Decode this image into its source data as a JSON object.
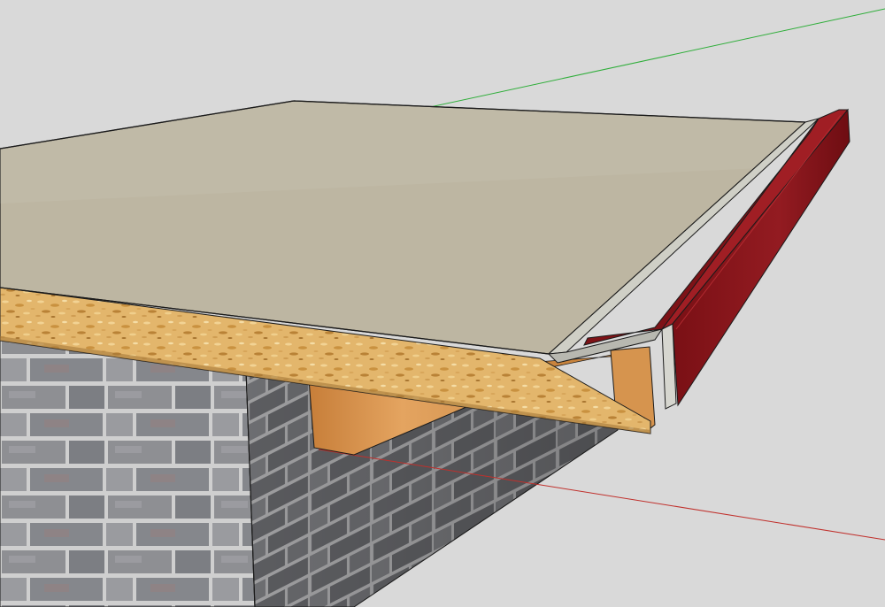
{
  "viewport": {
    "background": "#d9d9d9"
  },
  "axes": {
    "green_axis_color": "#2fae3a",
    "red_axis_color": "#c0302c"
  },
  "model": {
    "roof_membrane_color": "#bdb6a2",
    "osb_deck_color": "#e0b46a",
    "fascia_trim_color": "#8a1419",
    "drip_edge_color": "#b8b8b0",
    "wood_block_color": "#d9954a",
    "brick_color": "#8d8d8f",
    "mortar_color": "#cfcfcf",
    "edge_color": "#1b1b1b"
  }
}
